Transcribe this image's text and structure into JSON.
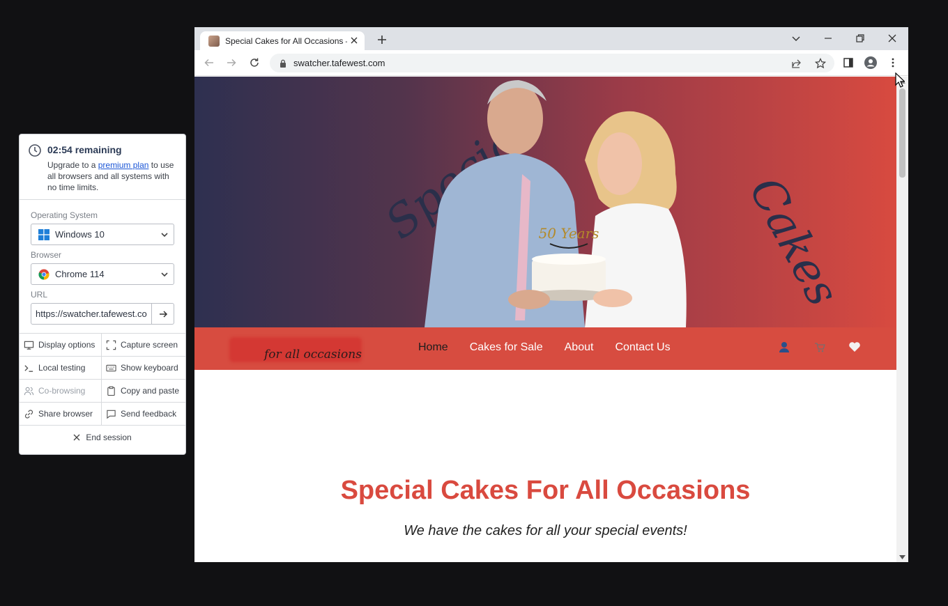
{
  "panel": {
    "timer": "02:54 remaining",
    "upgrade_pre": "Upgrade to a ",
    "upgrade_link": "premium plan",
    "upgrade_post": " to use all browsers and all systems with no time limits.",
    "os_label": "Operating System",
    "os_value": "Windows 10",
    "browser_label": "Browser",
    "browser_value": "Chrome 114",
    "url_label": "URL",
    "url_value": "https://swatcher.tafewest.com",
    "actions": [
      {
        "label": "Display options",
        "icon": "monitor-icon"
      },
      {
        "label": "Capture screen",
        "icon": "capture-icon"
      },
      {
        "label": "Local testing",
        "icon": "terminal-icon"
      },
      {
        "label": "Show keyboard",
        "icon": "keyboard-icon"
      },
      {
        "label": "Co-browsing",
        "icon": "users-icon",
        "disabled": true
      },
      {
        "label": "Copy and paste",
        "icon": "clipboard-icon"
      },
      {
        "label": "Share browser",
        "icon": "link-icon"
      },
      {
        "label": "Send feedback",
        "icon": "feedback-icon"
      }
    ],
    "end_session": "End session"
  },
  "browser": {
    "tab_title": "Special Cakes for All Occasions – ",
    "address": "swatcher.tafewest.com"
  },
  "site": {
    "hero_left_word": "Special",
    "hero_right_word": "Cakes",
    "cake_topper": "50 Years",
    "tagline": "for all occasions",
    "menu": [
      "Home",
      "Cakes for Sale",
      "About",
      "Contact Us"
    ],
    "active_menu": "Home",
    "headline": "Special Cakes For All Occasions",
    "subline": "We have the cakes for all your special events!",
    "colors": {
      "brand_red": "#d74c40",
      "headline_red": "#d94a3f"
    }
  }
}
